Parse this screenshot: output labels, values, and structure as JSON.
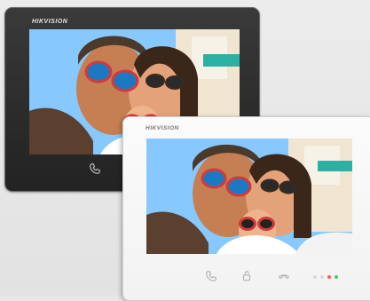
{
  "brand": "HIKVISION",
  "colors": {
    "dark_body": "#2b2b2b",
    "white_body": "#f5f5f5",
    "led_red": "#ff5b5b",
    "led_green": "#4cc36b"
  },
  "icons": {
    "dark_call": "phone-icon",
    "white_call": "phone-icon",
    "white_unlock": "unlock-icon",
    "white_hangup": "hangup-icon"
  }
}
